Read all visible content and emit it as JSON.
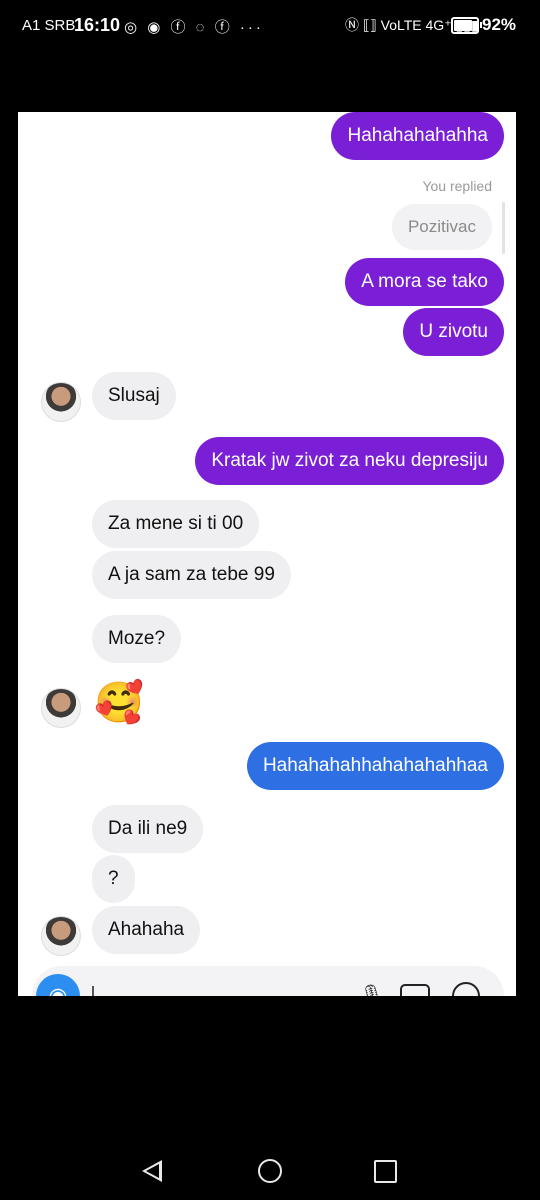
{
  "status_bar": {
    "carrier": "A1 SRB",
    "time": "16:10",
    "left_icons": [
      "instagram-icon",
      "threads-icon",
      "facebook-icon",
      "messenger-icon",
      "facebook-icon",
      "more-icon"
    ],
    "left_icons_text": "◎ ◉ ⓕ ◌ ⓕ ···",
    "right_icons_text": "Ⓝ ⟦⟧ VoLTE 4G⁺ ▮▮▮",
    "battery_level": 0.92,
    "battery_pct": "92%"
  },
  "chat": {
    "reply_label": "You replied",
    "messages": [
      {
        "from": "me",
        "text": "Hahahahahahha"
      },
      {
        "from": "quote",
        "text": "Pozitivac"
      },
      {
        "from": "me",
        "text": "A mora se tako"
      },
      {
        "from": "me",
        "text": "U zivotu"
      },
      {
        "from": "them",
        "text": "Slusaj"
      },
      {
        "from": "me",
        "text": "Kratak jw zivot za neku depresiju"
      },
      {
        "from": "them",
        "text": "Za mene si ti 00"
      },
      {
        "from": "them",
        "text": "A ja sam za tebe 99"
      },
      {
        "from": "them",
        "text": "Moze?"
      },
      {
        "from": "them",
        "text": "🥰"
      },
      {
        "from": "me",
        "text": "Hahahahahhahahahahhaa"
      },
      {
        "from": "them",
        "text": "Da ili ne9"
      },
      {
        "from": "them",
        "text": "?"
      },
      {
        "from": "them",
        "text": "Ahahaha"
      }
    ]
  },
  "composer": {
    "camera_icon": "camera-icon",
    "camera_glyph": "◉"
  },
  "colors": {
    "my_bubble": "#7a1fd6",
    "my_bubble_blue": "#2f6fe4",
    "their_bubble": "#efeff1",
    "background": "#000000"
  }
}
